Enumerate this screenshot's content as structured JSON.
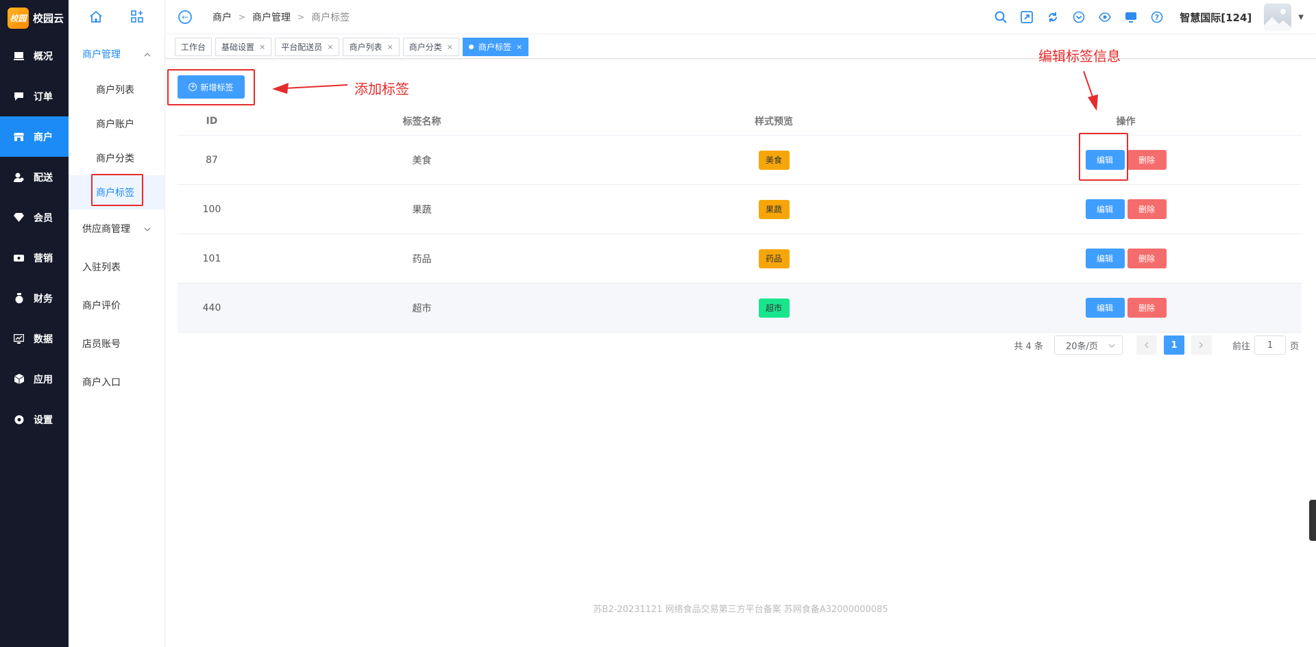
{
  "nav": {
    "logo_mark": "校园",
    "logo_text": "校园云",
    "items": [
      {
        "label": "概况",
        "icon": "overview-icon"
      },
      {
        "label": "订单",
        "icon": "order-icon"
      },
      {
        "label": "商户",
        "icon": "merchant-icon",
        "active": true
      },
      {
        "label": "配送",
        "icon": "delivery-icon"
      },
      {
        "label": "会员",
        "icon": "member-icon"
      },
      {
        "label": "营销",
        "icon": "marketing-icon"
      },
      {
        "label": "财务",
        "icon": "finance-icon"
      },
      {
        "label": "数据",
        "icon": "data-icon"
      },
      {
        "label": "应用",
        "icon": "app-icon"
      },
      {
        "label": "设置",
        "icon": "settings-icon"
      }
    ]
  },
  "submenu": {
    "group_open": "商户管理",
    "items": [
      "商户列表",
      "商户账户",
      "商户分类",
      "商户标签"
    ],
    "group_supplier": "供应商管理",
    "plain": [
      "入驻列表",
      "商户评价",
      "店员账号",
      "商户入口"
    ]
  },
  "header": {
    "breadcrumb": [
      "商户",
      "商户管理",
      "商户标签"
    ],
    "user": "智慧国际[124]"
  },
  "tabs": [
    {
      "label": "工作台",
      "closable": false
    },
    {
      "label": "基础设置",
      "closable": true
    },
    {
      "label": "平台配送员",
      "closable": true
    },
    {
      "label": "商户列表",
      "closable": true
    },
    {
      "label": "商户分类",
      "closable": true
    },
    {
      "label": "商户标签",
      "closable": true,
      "active": true
    }
  ],
  "main": {
    "add_label": "新增标签",
    "columns": [
      "ID",
      "标签名称",
      "样式预览",
      "操作"
    ],
    "rows": [
      {
        "id": "87",
        "name": "美食",
        "badge": "美食",
        "color": "#f7a60a"
      },
      {
        "id": "100",
        "name": "果蔬",
        "badge": "果蔬",
        "color": "#f7a60a"
      },
      {
        "id": "101",
        "name": "药品",
        "badge": "药品",
        "color": "#f7a60a"
      },
      {
        "id": "440",
        "name": "超市",
        "badge": "超市",
        "color": "#19e58d"
      }
    ],
    "edit_label": "编辑",
    "delete_label": "删除"
  },
  "pagination": {
    "total": "共 4 条",
    "page_size": "20条/页",
    "current": "1",
    "goto_prefix": "前往",
    "goto_value": "1",
    "goto_suffix": "页"
  },
  "footer": "苏B2-20231121  网络食品交易第三方平台备案 苏网食备A32000000085",
  "annotations": {
    "add": "添加标签",
    "edit": "编辑标签信息"
  },
  "colors": {
    "primary": "#409eff",
    "danger": "#f56c6c",
    "nav_bg": "#16192a",
    "nav_active": "#1c8bf6",
    "annotation": "#e62b2b"
  }
}
